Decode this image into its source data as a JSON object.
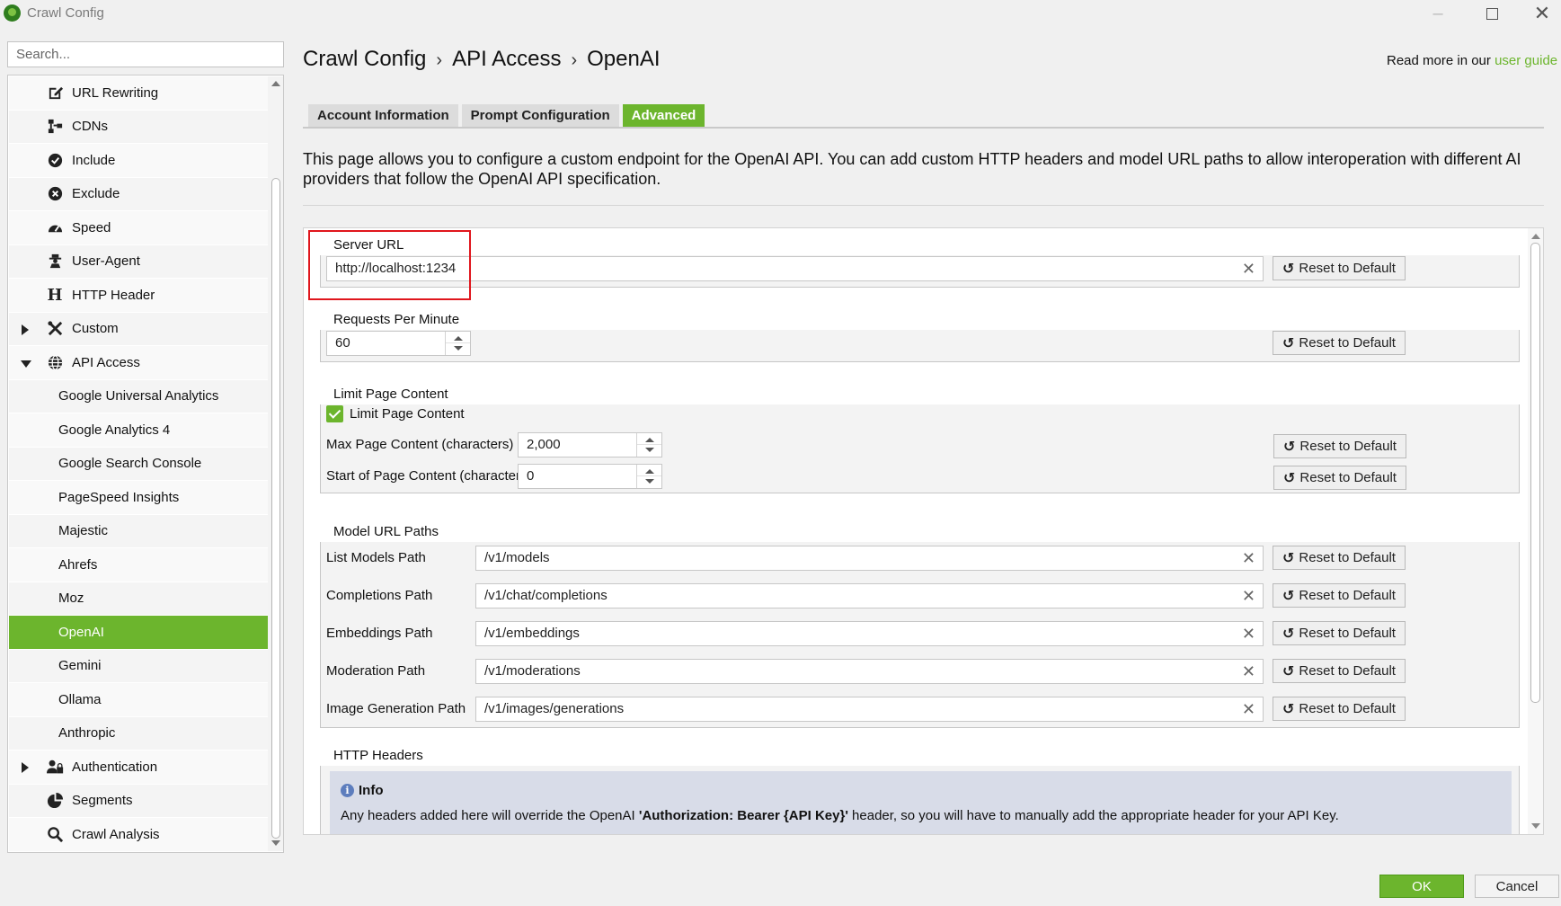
{
  "window": {
    "title": "Crawl Config"
  },
  "search": {
    "placeholder": "Search..."
  },
  "sidebar": {
    "items": [
      {
        "label": "URL Rewriting",
        "icon": "edit-icon"
      },
      {
        "label": "CDNs",
        "icon": "network-icon"
      },
      {
        "label": "Include",
        "icon": "check-circle-icon"
      },
      {
        "label": "Exclude",
        "icon": "x-circle-icon"
      },
      {
        "label": "Speed",
        "icon": "speedometer-icon"
      },
      {
        "label": "User-Agent",
        "icon": "user-secret-icon"
      },
      {
        "label": "HTTP Header",
        "icon": "h-letter-icon"
      },
      {
        "label": "Custom",
        "icon": "tools-icon"
      },
      {
        "label": "API Access",
        "icon": "globe-icon"
      },
      {
        "label": "Google Universal Analytics"
      },
      {
        "label": "Google Analytics 4"
      },
      {
        "label": "Google Search Console"
      },
      {
        "label": "PageSpeed Insights"
      },
      {
        "label": "Majestic"
      },
      {
        "label": "Ahrefs"
      },
      {
        "label": "Moz"
      },
      {
        "label": "OpenAI"
      },
      {
        "label": "Gemini"
      },
      {
        "label": "Ollama"
      },
      {
        "label": "Anthropic"
      },
      {
        "label": "Authentication",
        "icon": "user-lock-icon"
      },
      {
        "label": "Segments",
        "icon": "pie-chart-icon"
      },
      {
        "label": "Crawl Analysis",
        "icon": "search-icon"
      }
    ],
    "selected": "OpenAI"
  },
  "header": {
    "breadcrumb": [
      "Crawl Config",
      "API Access",
      "OpenAI"
    ],
    "breadcrumb_sep": "›",
    "readmore_prefix": "Read more in our",
    "readmore_link": "user guide"
  },
  "tabs": [
    "Account Information",
    "Prompt Configuration",
    "Advanced"
  ],
  "active_tab": "Advanced",
  "description": "This page allows you to configure a custom endpoint for the OpenAI API. You can add custom HTTP headers and model URL paths to allow interoperation with different AI providers that follow the OpenAI API specification.",
  "reset_label": "Reset to Default",
  "server_url": {
    "title": "Server URL",
    "value": "http://localhost:1234"
  },
  "rpm": {
    "title": "Requests Per Minute",
    "value": "60"
  },
  "limit": {
    "title": "Limit Page Content",
    "checkbox_label": "Limit Page Content",
    "checked": true,
    "max_label": "Max Page Content (characters)",
    "max_value": "2,000",
    "start_label": "Start of Page Content (characters)",
    "start_value": "0"
  },
  "paths": {
    "title": "Model URL Paths",
    "rows": [
      {
        "label": "List  Models Path",
        "value": "/v1/models"
      },
      {
        "label": "Completions Path",
        "value": "/v1/chat/completions"
      },
      {
        "label": "Embeddings Path",
        "value": "/v1/embeddings"
      },
      {
        "label": "Moderation Path",
        "value": "/v1/moderations"
      },
      {
        "label": "Image Generation Path",
        "value": "/v1/images/generations"
      }
    ]
  },
  "headers": {
    "title": "HTTP Headers",
    "info_title": "Info",
    "info_pre": "Any headers added here will override the OpenAI ",
    "info_bold": "'Authorization: Bearer {API Key}'",
    "info_post": " header, so you will have to manually add the appropriate header for your API Key."
  },
  "footer": {
    "ok": "OK",
    "cancel": "Cancel"
  },
  "colors": {
    "accent": "#6cb52d",
    "highlight": "#e0161d",
    "info_bg": "#d8dce8"
  }
}
